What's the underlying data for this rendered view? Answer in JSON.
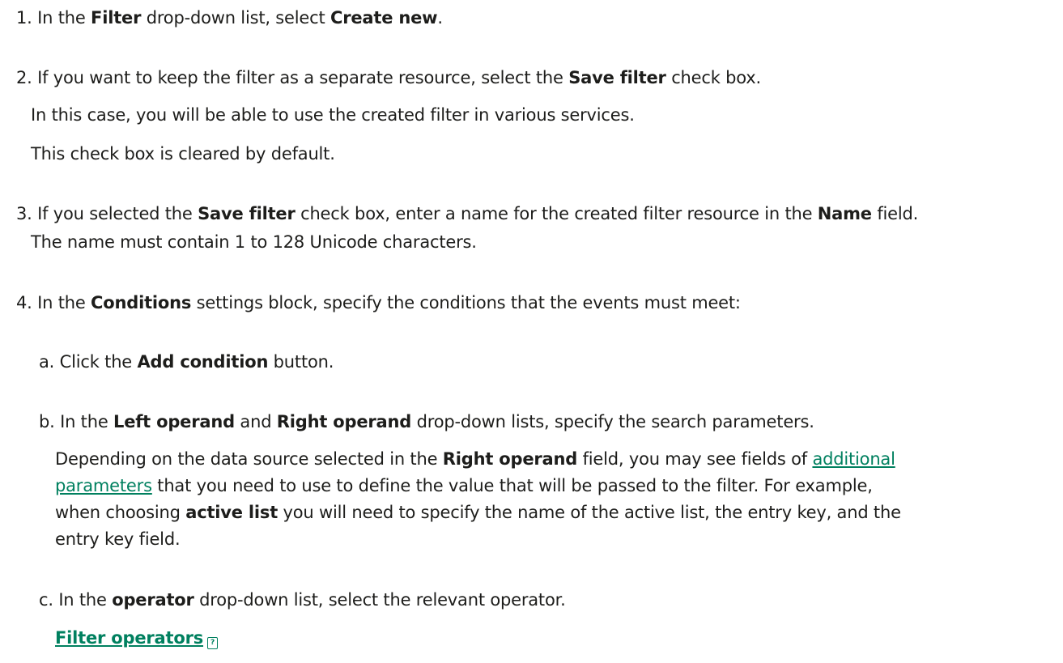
{
  "steps": {
    "s1": {
      "num": "1.",
      "t1": "In the ",
      "b1": "Filter",
      "t2": " drop-down list, select ",
      "b2": "Create new",
      "t3": "."
    },
    "s2": {
      "num": "2.",
      "t1": "If you want to keep the filter as a separate resource, select the ",
      "b1": "Save filter",
      "t2": " check box.",
      "p1": "In this case, you will be able to use the created filter in various services.",
      "p2": "This check box is cleared by default."
    },
    "s3": {
      "num": "3.",
      "t1": "If you selected the ",
      "b1": "Save filter",
      "t2": " check box, enter a name for the created filter resource in the ",
      "b2": "Name",
      "t3": " field.",
      "t4": "The name must contain 1 to 128 Unicode characters."
    },
    "s4": {
      "num": "4.",
      "t1": "In the ",
      "b1": "Conditions",
      "t2": " settings block, specify the conditions that the events must meet:"
    }
  },
  "substeps": {
    "a": {
      "num": "a.",
      "t1": "Click the ",
      "b1": "Add condition",
      "t2": " button."
    },
    "b": {
      "num": "b.",
      "t1": "In the ",
      "b1": "Left operand",
      "t2": " and ",
      "b2": "Right operand",
      "t3": " drop-down lists, specify the search parameters.",
      "p1": "Depending on the data source selected in the ",
      "p1b": "Right operand",
      "p1c": " field, you may see fields of ",
      "link1": "additional",
      "link2": "parameters",
      "p2": " that you need to use to define the value that will be passed to the filter. For example,",
      "p3a": "when choosing ",
      "p3b": "active list",
      "p3c": " you will need to specify the name of the active list, the entry key, and the",
      "p4": "entry key field."
    },
    "c": {
      "num": "c.",
      "t1": "In the ",
      "b1": "operator",
      "t2": " drop-down list, select the relevant operator.",
      "link": "Filter operators",
      "link_icon": "help-icon"
    }
  }
}
